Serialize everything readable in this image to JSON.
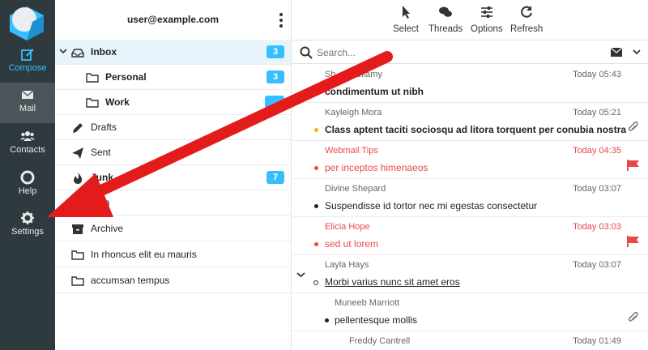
{
  "rail": {
    "items": [
      {
        "label": "Compose",
        "icon": "compose-icon"
      },
      {
        "label": "Mail",
        "icon": "mail-icon"
      },
      {
        "label": "Contacts",
        "icon": "contacts-icon"
      },
      {
        "label": "Help",
        "icon": "help-icon"
      },
      {
        "label": "Settings",
        "icon": "gear-icon"
      }
    ]
  },
  "folders": {
    "user": "user@example.com",
    "items": [
      {
        "name": "Inbox",
        "badge": "3",
        "icon": "inbox-icon"
      },
      {
        "name": "Personal",
        "badge": "3",
        "icon": "folder-icon"
      },
      {
        "name": "Work",
        "badge": "",
        "icon": "folder-icon"
      },
      {
        "name": "Drafts",
        "badge": "",
        "icon": "pencil-icon"
      },
      {
        "name": "Sent",
        "badge": "",
        "icon": "paper-plane-icon"
      },
      {
        "name": "Junk",
        "badge": "7",
        "icon": "fire-icon"
      },
      {
        "name": "rash",
        "badge": "",
        "icon": "trash-icon"
      },
      {
        "name": "Archive",
        "badge": "",
        "icon": "archive-icon"
      },
      {
        "name": "In rhoncus elit eu mauris",
        "badge": "",
        "icon": "folder-icon"
      },
      {
        "name": "accumsan tempus",
        "badge": "",
        "icon": "folder-icon"
      }
    ]
  },
  "toolbar": {
    "select": "Select",
    "threads": "Threads",
    "options": "Options",
    "refresh": "Refresh"
  },
  "search": {
    "placeholder": "Search..."
  },
  "messages": [
    {
      "from": "Sh...n Bellamy",
      "date": "Today 05:43",
      "subject": "condimentum ut nibh"
    },
    {
      "from": "Kayleigh Mora",
      "date": "Today 05:21",
      "subject": "Class aptent taciti sociosqu ad litora torquent per conubia nostra"
    },
    {
      "from": "Webmail Tips",
      "date": "Today 04:35",
      "subject": "per inceptos himenaeos"
    },
    {
      "from": "Divine Shepard",
      "date": "Today 03:07",
      "subject": "Suspendisse id tortor nec mi egestas consectetur"
    },
    {
      "from": "Elicia Hope",
      "date": "Today 03:03",
      "subject": "sed ut lorem"
    },
    {
      "from": "Layla Hays",
      "date": "Today 03:07",
      "subject": "Morbi varius nunc sit amet eros"
    },
    {
      "from": "Muneeb Marriott",
      "date": "",
      "subject": "pellentesque mollis"
    },
    {
      "from": "Freddy Cantrell",
      "date": "Today 01:49",
      "subject": ""
    }
  ],
  "colors": {
    "accent": "#37beff",
    "flag": "#e94848",
    "unread_dot": "#f4b400",
    "rail_bg": "#2f3a3f",
    "annotation_arrow": "#e41b1b"
  }
}
